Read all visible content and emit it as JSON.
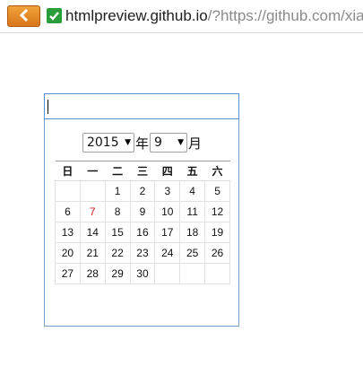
{
  "browser": {
    "url_host": "htmlpreview.github.io",
    "url_rest": "/?https://github.com/xia"
  },
  "datepicker": {
    "input_value": "",
    "year": "2015",
    "year_unit": "年",
    "month": "9",
    "month_unit": "月",
    "weekdays": [
      "日",
      "一",
      "二",
      "三",
      "四",
      "五",
      "六"
    ],
    "weeks": [
      [
        "",
        "",
        "1",
        "2",
        "3",
        "4",
        "5"
      ],
      [
        "6",
        "7",
        "8",
        "9",
        "10",
        "11",
        "12"
      ],
      [
        "13",
        "14",
        "15",
        "16",
        "17",
        "18",
        "19"
      ],
      [
        "20",
        "21",
        "22",
        "23",
        "24",
        "25",
        "26"
      ],
      [
        "27",
        "28",
        "29",
        "30",
        "",
        "",
        ""
      ]
    ],
    "highlighted_day": "7",
    "highlight_color": "#d21f1f"
  },
  "colors": {
    "accent_border": "#5a8fd6",
    "back_button": "#e38b27",
    "secure_badge": "#2a9e3a"
  },
  "icons": {
    "back": "back-arrow-icon",
    "secure": "secure-check-icon",
    "dropdown": "dropdown-arrow-icon"
  }
}
